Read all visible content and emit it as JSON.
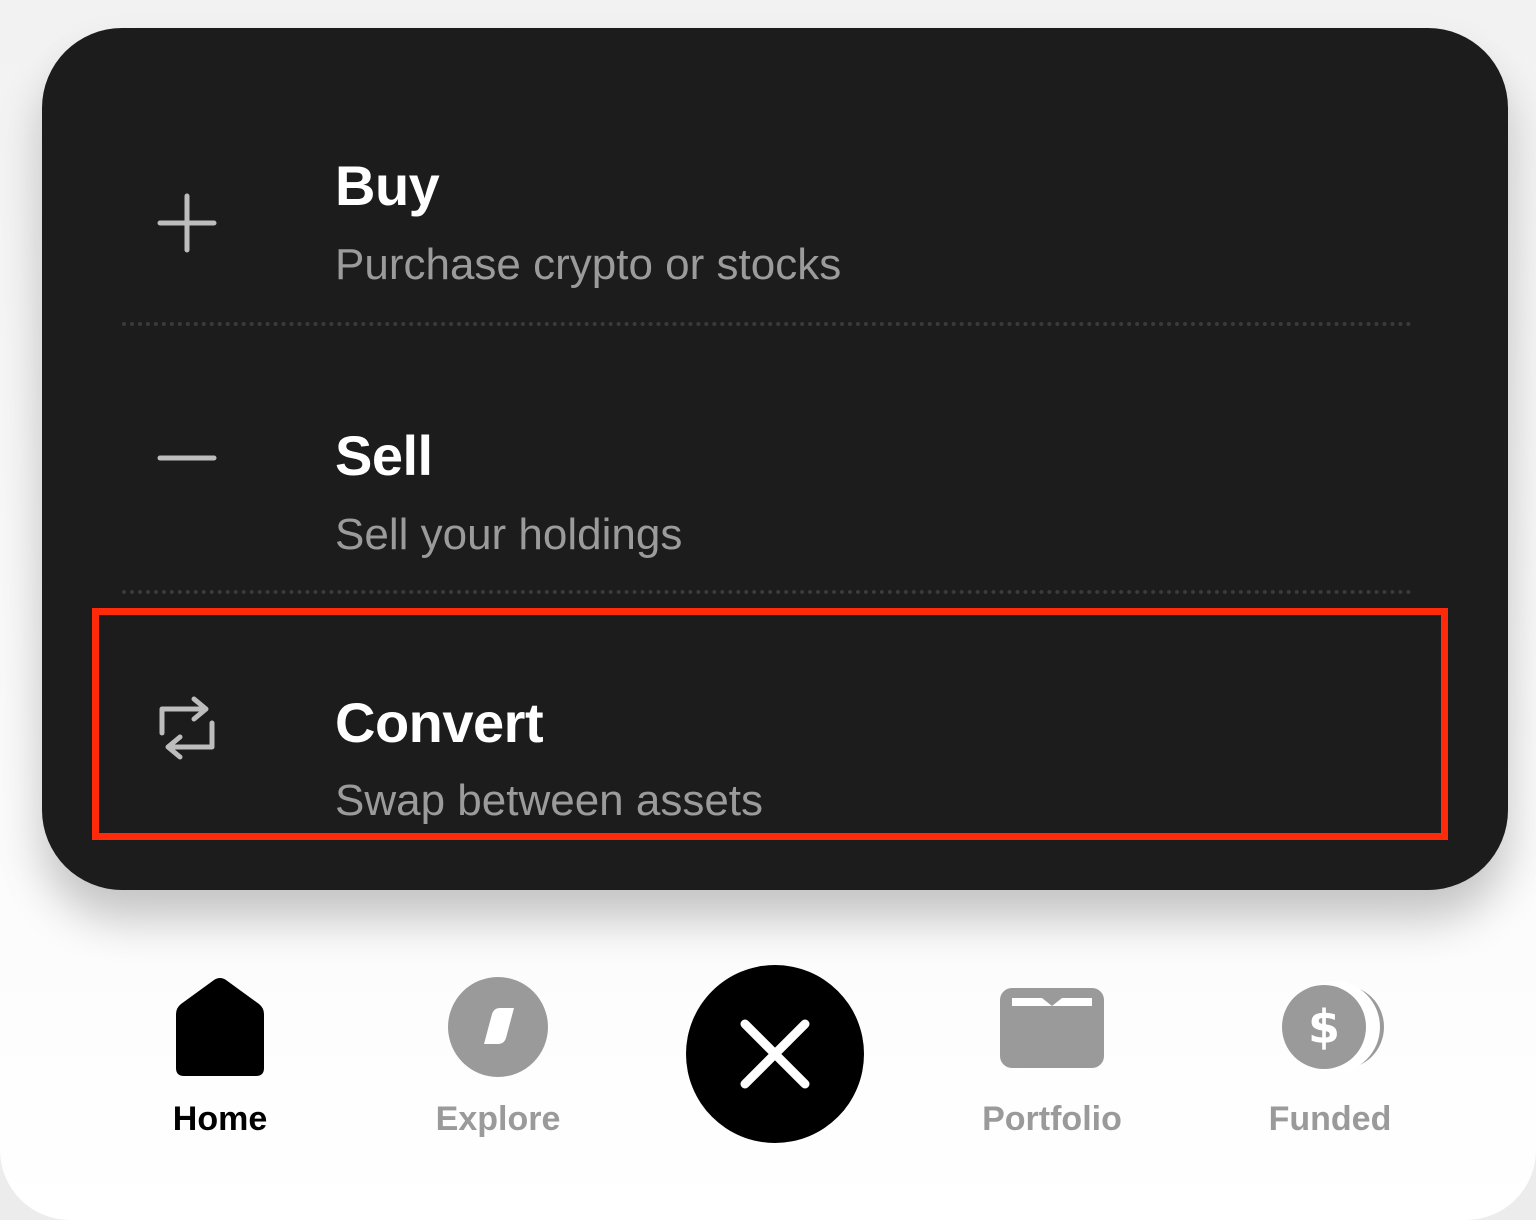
{
  "menu": {
    "items": [
      {
        "icon": "plus-icon",
        "title": "Buy",
        "subtitle": "Purchase crypto or stocks"
      },
      {
        "icon": "minus-icon",
        "title": "Sell",
        "subtitle": "Sell your holdings"
      },
      {
        "icon": "swap-arrows-icon",
        "title": "Convert",
        "subtitle": "Swap between assets"
      }
    ],
    "highlighted_item": "Convert"
  },
  "tabbar": {
    "tabs": [
      {
        "icon": "home-icon",
        "label": "Home",
        "active": true
      },
      {
        "icon": "compass-icon",
        "label": "Explore",
        "active": false
      },
      {
        "icon": "wallet-icon",
        "label": "Portfolio",
        "active": false
      },
      {
        "icon": "coins-icon",
        "label": "Funded",
        "active": false
      }
    ],
    "center_button_icon": "close-icon"
  },
  "colors": {
    "sheet_background": "#1c1c1c",
    "title_text": "#ffffff",
    "subtitle_text": "#9b9b9b",
    "highlight_border": "#ff2a0a",
    "active_tab": "#000000",
    "inactive_tab": "#9a9a9a"
  }
}
